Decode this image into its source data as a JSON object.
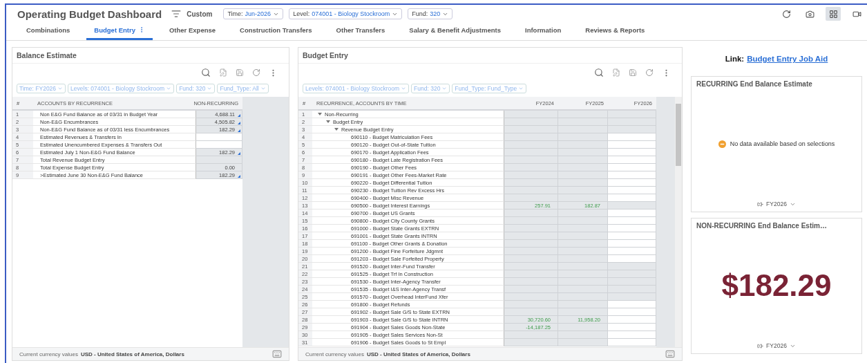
{
  "header": {
    "title": "Operating Budget Dashboard",
    "view": "Custom",
    "filters": [
      {
        "label": "Time:",
        "value": "Jun-2026"
      },
      {
        "label": "Level:",
        "value": "074001 - Biology Stockroom"
      },
      {
        "label": "Fund:",
        "value": "320"
      }
    ]
  },
  "view_buttons": [
    {
      "kind": "refresh",
      "selected": false
    },
    {
      "kind": "snapshot",
      "selected": false
    },
    {
      "kind": "grid",
      "selected": true
    },
    {
      "kind": "present",
      "selected": false
    }
  ],
  "tabs": [
    {
      "label": "Combinations",
      "selected": false
    },
    {
      "label": "Budget Entry",
      "selected": true
    },
    {
      "label": "Other Expense",
      "selected": false
    },
    {
      "label": "Construction Transfers",
      "selected": false
    },
    {
      "label": "Other Transfers",
      "selected": false
    },
    {
      "label": "Salary & Benefit Adjustments",
      "selected": false
    },
    {
      "label": "Information",
      "selected": false
    },
    {
      "label": "Reviews & Reports",
      "selected": false
    }
  ],
  "balance_estimate": {
    "title": "Balance Estimate",
    "filters": [
      "Time: FY2026",
      "Levels: 074001 - Biology Stockroom",
      "Fund: 320",
      "Fund_Type: All"
    ],
    "columns": [
      "#",
      "ACCOUNTS BY RECURRENCE",
      "NON-RECURRING"
    ],
    "rows": [
      {
        "number": "1",
        "account": "Non E&G Fund Balance as of 03/31 in Budget Year",
        "value": "4,688.11",
        "editable": false,
        "flagged": true
      },
      {
        "number": "2",
        "account": "Non-E&G Encumbrances",
        "value": "4,505.82",
        "editable": false,
        "flagged": true
      },
      {
        "number": "3",
        "account": "Non-E&G Fund Balance as of 03/31 less Encumbrances",
        "value": "182.29",
        "editable": false,
        "flagged": true
      },
      {
        "number": "4",
        "account": "Estimated Revenues & Transfers In",
        "editable": true,
        "flagged": false
      },
      {
        "number": "5",
        "account": "Estimated Unencumbered Expenses & Transfers Out",
        "editable": true,
        "flagged": false
      },
      {
        "number": "6",
        "account": "Estimated July 1 Non-E&G Fund Balance",
        "value": "182.29",
        "editable": false,
        "flagged": true
      },
      {
        "number": "7",
        "account": "Total Revenue Budget Entry",
        "editable": false,
        "flagged": false
      },
      {
        "number": "8",
        "account": "Total Expense Budget Entry",
        "value": "0.00",
        "editable": false,
        "flagged": false
      },
      {
        "number": "9",
        "account": ">Estimated June 30 Non-E&G Fund Balance",
        "value": "182.29",
        "editable": false,
        "flagged": true
      }
    ],
    "footer": {
      "label": "Current currency values",
      "value": "USD - United States of America, Dollars"
    }
  },
  "budget_entry": {
    "title": "Budget Entry",
    "filters": [
      "Levels: 074001 - Biology Stockroom",
      "Fund: 320",
      "Fund_Type: Fund_Type"
    ],
    "columns": [
      "#",
      "RECURRENCE, ACCOUNTS BY TIME",
      "FY2024",
      "FY2025",
      "FY2026"
    ],
    "rows": [
      {
        "number": "1",
        "label": "Non-Recurring",
        "expanded": true,
        "fy2026_editable": false,
        "children": [
          {
            "number": "2",
            "label": "Budget Entry",
            "expanded": true,
            "fy2026_editable": false,
            "children": [
              {
                "number": "3",
                "label": "Revenue Budget Entry",
                "expanded": true,
                "fy2026_editable": false,
                "children": [
                  {
                    "number": "4",
                    "label": "690110 - Budget Matriculation Fees",
                    "fy2026_editable": true
                  },
                  {
                    "number": "5",
                    "label": "690120 - Budget Out-of-State Tuition",
                    "fy2026_editable": true
                  },
                  {
                    "number": "6",
                    "label": "690170 - Budget Application Fees",
                    "fy2026_editable": true
                  },
                  {
                    "number": "7",
                    "label": "690180 - Budget Late Registration Fees",
                    "fy2026_editable": true
                  },
                  {
                    "number": "8",
                    "label": "690190 - Budget Other Fees",
                    "fy2026_editable": true
                  },
                  {
                    "number": "9",
                    "label": "690191 - Budget Other Fees-Market Rate",
                    "fy2026_editable": true
                  },
                  {
                    "number": "10",
                    "label": "690220 - Budget Differential Tuition",
                    "fy2026_editable": true
                  },
                  {
                    "number": "11",
                    "label": "690230 - Budget Tuition Rev Excess Hrs",
                    "fy2026_editable": true
                  },
                  {
                    "number": "12",
                    "label": "690400 - Budget Misc Revenue",
                    "fy2026_editable": true
                  },
                  {
                    "number": "13",
                    "label": "690500 - Budget Interest Earnings",
                    "fy2024": "257.91",
                    "fy2025": "182.87",
                    "fy2026_editable": false
                  },
                  {
                    "number": "14",
                    "label": "690700 - Budget US Grants",
                    "fy2026_editable": true
                  },
                  {
                    "number": "15",
                    "label": "690800 - Budget City County Grants",
                    "fy2026_editable": true
                  },
                  {
                    "number": "16",
                    "label": "691000 - Budget State Grants EXTRN",
                    "fy2026_editable": true
                  },
                  {
                    "number": "17",
                    "label": "691001 - Budget State Grants INTRN",
                    "fy2026_editable": true
                  },
                  {
                    "number": "18",
                    "label": "691100 - Budget Other Grants & Donation",
                    "fy2026_editable": true
                  },
                  {
                    "number": "19",
                    "label": "691200 - Budget Fine Forfeiture Jdgmnt",
                    "fy2026_editable": true
                  },
                  {
                    "number": "20",
                    "label": "691203 - Budget Sale Forfeited Property",
                    "fy2026_editable": true
                  },
                  {
                    "number": "21",
                    "label": "691520 - Budget Inter-Fund Transfer",
                    "fy2026_editable": false
                  },
                  {
                    "number": "22",
                    "label": "691525 - Budget Trf In Construction",
                    "fy2026_editable": false
                  },
                  {
                    "number": "23",
                    "label": "691530 - Budget Inter-Agency Transfer",
                    "fy2026_editable": false
                  },
                  {
                    "number": "24",
                    "label": "691535 - Budget I&S Inter-Agency Transf",
                    "fy2026_editable": false
                  },
                  {
                    "number": "25",
                    "label": "691570 - Budget Overhead InterFund Xfer",
                    "fy2026_editable": false
                  },
                  {
                    "number": "26",
                    "label": "691800 - Budget Refunds",
                    "fy2026_editable": true
                  },
                  {
                    "number": "27",
                    "label": "691902 - Budget Sale G/S to State EXTRN",
                    "fy2026_editable": true
                  },
                  {
                    "number": "28",
                    "label": "691903 - Budget Sale G/S to State INTRN",
                    "fy2024": "30,720.60",
                    "fy2025": "11,958.20",
                    "fy2026_editable": true
                  },
                  {
                    "number": "29",
                    "label": "691904 - Budget Sales Goods Non-State",
                    "fy2024": "-14,187.25",
                    "fy2026_editable": true
                  },
                  {
                    "number": "30",
                    "label": "691905 - Budget Sales Services Non-St",
                    "fy2026_editable": true
                  },
                  {
                    "number": "31",
                    "label": "691906 - Budget Sales Goods to St Empl",
                    "fy2026_editable": true
                  }
                ]
              }
            ]
          }
        ]
      }
    ],
    "footer": {
      "label": "Current currency values",
      "value": "USD - United States of America, Dollars"
    }
  },
  "link": {
    "label": "Link:",
    "text": "Budget Entry Job Aid"
  },
  "cards": [
    {
      "kind": "empty",
      "title": "RECURRING End Balance Estimate",
      "message": "No data available based on selections",
      "period": "FY2026"
    },
    {
      "kind": "value",
      "title": "NON-RECURRING End Balance Estim…",
      "value": "$182.29",
      "period": "FY2026"
    }
  ]
}
